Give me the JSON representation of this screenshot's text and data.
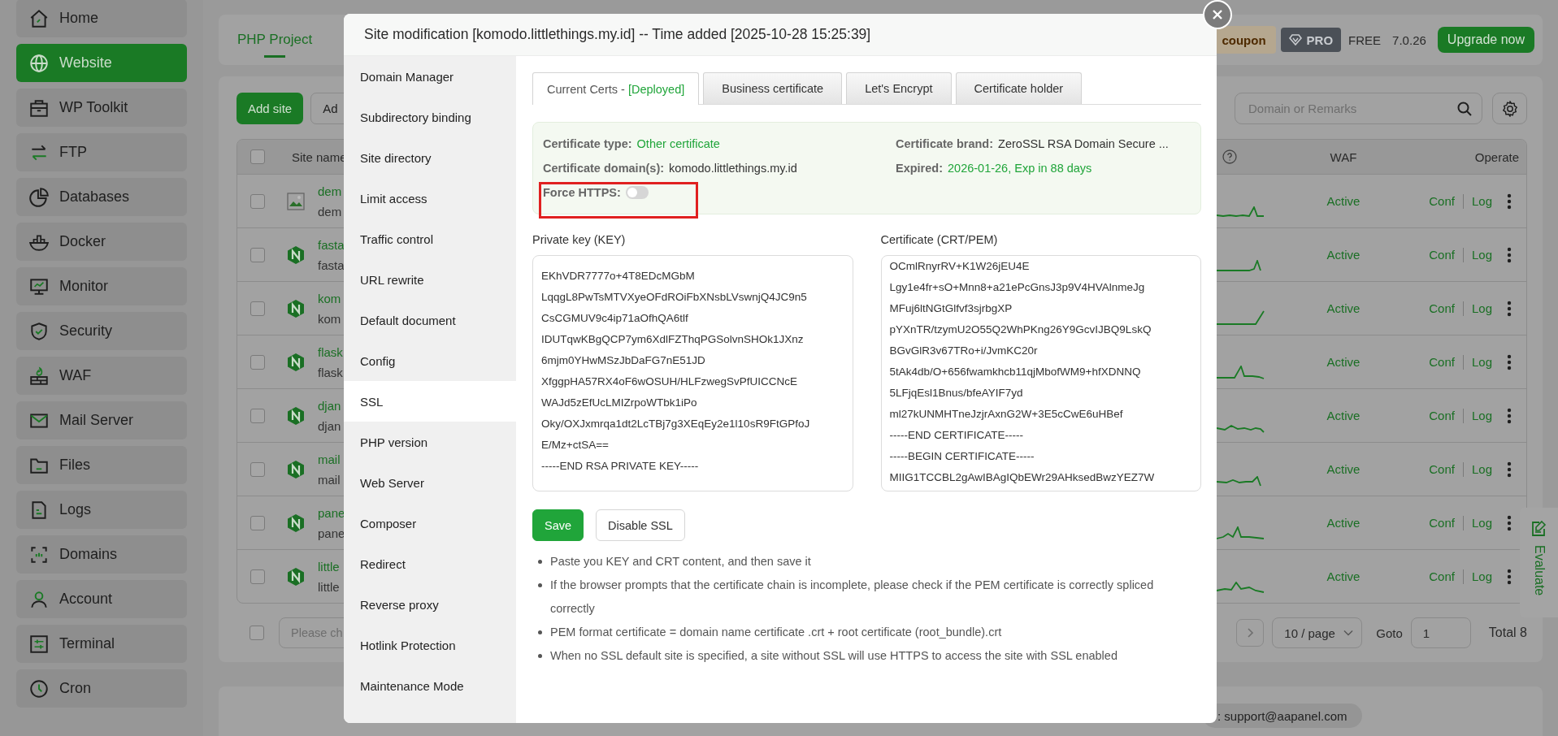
{
  "sidebar": {
    "items": [
      {
        "label": "Home",
        "selected": false
      },
      {
        "label": "Website",
        "selected": true
      },
      {
        "label": "WP Toolkit",
        "selected": false
      },
      {
        "label": "FTP",
        "selected": false
      },
      {
        "label": "Databases",
        "selected": false
      },
      {
        "label": "Docker",
        "selected": false
      },
      {
        "label": "Monitor",
        "selected": false
      },
      {
        "label": "Security",
        "selected": false
      },
      {
        "label": "WAF",
        "selected": false
      },
      {
        "label": "Mail Server",
        "selected": false
      },
      {
        "label": "Files",
        "selected": false
      },
      {
        "label": "Logs",
        "selected": false
      },
      {
        "label": "Domains",
        "selected": false
      },
      {
        "label": "Account",
        "selected": false
      },
      {
        "label": "Terminal",
        "selected": false
      },
      {
        "label": "Cron",
        "selected": false
      }
    ]
  },
  "header": {
    "tabs": [
      {
        "label": "PHP Project",
        "selected": true
      }
    ],
    "coupon": "coupon",
    "pro_badge": "PRO",
    "edition": "FREE",
    "version": "7.0.26",
    "upgrade_button": "Upgrade now"
  },
  "toolbar": {
    "add_site_button": "Add site",
    "second_button": "Ad",
    "search": {
      "placeholder": "Domain or Remarks"
    }
  },
  "table": {
    "select_all_checked": false,
    "columns": {
      "name": "Site name",
      "waf": "WAF",
      "operate": "Operate"
    },
    "rows": [
      {
        "kind": "image",
        "checked": false,
        "name": "dem",
        "remark": "dem",
        "waf": "Active",
        "conf": "Conf",
        "log": "Log"
      },
      {
        "kind": "nginx",
        "checked": false,
        "name": "fasta",
        "remark": "fasta",
        "waf": "Active",
        "conf": "Conf",
        "log": "Log"
      },
      {
        "kind": "nginx",
        "checked": false,
        "name": "kom",
        "remark": "kom",
        "waf": "Active",
        "conf": "Conf",
        "log": "Log"
      },
      {
        "kind": "nginx",
        "checked": false,
        "name": "flask",
        "remark": "flask",
        "waf": "Active",
        "conf": "Conf",
        "log": "Log"
      },
      {
        "kind": "nginx",
        "checked": false,
        "name": "djan",
        "remark": "djan",
        "waf": "Active",
        "conf": "Conf",
        "log": "Log"
      },
      {
        "kind": "nginx",
        "checked": false,
        "name": "mail",
        "remark": "mail",
        "waf": "Active",
        "conf": "Conf",
        "log": "Log"
      },
      {
        "kind": "nginx",
        "checked": false,
        "name": "pane",
        "remark": "pane",
        "waf": "Active",
        "conf": "Conf",
        "log": "Log"
      },
      {
        "kind": "nginx",
        "checked": false,
        "name": "little",
        "remark": "little",
        "waf": "Active",
        "conf": "Conf",
        "log": "Log"
      }
    ]
  },
  "footer": {
    "checked": false,
    "batch_select": {
      "placeholder": "Please ch"
    },
    "page_size": "10 / page",
    "goto_label": "Goto",
    "goto_value": "1",
    "total": "Total 8"
  },
  "support": ": support@aapanel.com",
  "evaluate": "Evaluate",
  "modal": {
    "title": "Site modification [komodo.littlethings.my.id] -- Time added [2025-10-28 15:25:39]",
    "nav": [
      {
        "label": "Domain Manager",
        "selected": false
      },
      {
        "label": "Subdirectory binding",
        "selected": false
      },
      {
        "label": "Site directory",
        "selected": false
      },
      {
        "label": "Limit access",
        "selected": false
      },
      {
        "label": "Traffic control",
        "selected": false
      },
      {
        "label": "URL rewrite",
        "selected": false
      },
      {
        "label": "Default document",
        "selected": false
      },
      {
        "label": "Config",
        "selected": false
      },
      {
        "label": "SSL",
        "selected": true
      },
      {
        "label": "PHP version",
        "selected": false
      },
      {
        "label": "Web Server",
        "selected": false
      },
      {
        "label": "Composer",
        "selected": false
      },
      {
        "label": "Redirect",
        "selected": false
      },
      {
        "label": "Reverse proxy",
        "selected": false
      },
      {
        "label": "Hotlink Protection",
        "selected": false
      },
      {
        "label": "Maintenance Mode",
        "selected": false
      }
    ],
    "tabs": [
      {
        "label": "Current Certs - ",
        "status": "[Deployed]",
        "selected": true
      },
      {
        "label": "Business certificate",
        "selected": false
      },
      {
        "label": "Let's Encrypt",
        "selected": false
      },
      {
        "label": "Certificate holder",
        "selected": false
      }
    ],
    "cert_info": {
      "type_label": "Certificate type:",
      "type": "Other certificate",
      "brand_label": "Certificate brand:",
      "brand": "ZeroSSL RSA Domain Secure ...",
      "domain_label": "Certificate domain(s):",
      "domain": "komodo.littlethings.my.id",
      "expired_label": "Expired:",
      "expired": "2026-01-26, Exp in 88 days",
      "force_https": {
        "label": "Force HTTPS:",
        "on": false,
        "highlighted": true
      }
    },
    "key": {
      "label": "Private key (KEY)",
      "lines": [
        "EKhVDR7777o+4T8EDcMGbM",
        "LqqgL8PwTsMTVXyeOFdROiFbXNsbLVswnjQ4JC9n5",
        "CsCGMUV9c4ip71aOfhQA6tlf",
        "IDUTqwKBgQCP7ym6XdlFZThqPGSolvnSHOk1JXnz",
        "6mjm0YHwMSzJbDaFG7nE51JD",
        "XfggpHA57RX4oF6wOSUH/HLFzwegSvPfUICCNcE",
        "WAJd5zEfUcLMIZrpoWTbk1iPo",
        "Oky/OXJxmrqa1dt2LcTBj7g3XEqEy2e1l10sR9FtGPfoJ",
        "E/Mz+ctSA==",
        "-----END RSA PRIVATE KEY-----"
      ]
    },
    "cert": {
      "label": "Certificate (CRT/PEM)",
      "lines": [
        "OCmlRnyrRV+K1W26jEU4E",
        "Lgy1e4fr+sO+Mnn8+a21ePcGnsJ3p9V4HVAlnmeJg",
        "MFuj6ltNGtGlfvf3sjrbgXP",
        "pYXnTR/tzymU2O55Q2WhPKng26Y9GcvIJBQ9LskQ",
        "BGvGlR3v67TRo+i/JvmKC20r",
        "5tAk4db/O+656fwamkhcb11qjMbofWM9+hfXDNNQ",
        "5LFjqEsl1Bnus/bfeAYIF7yd",
        "ml27kUNMHTneJzjrAxnG2W+3E5cCwE6uHBef",
        "-----END CERTIFICATE-----",
        "-----BEGIN CERTIFICATE-----",
        "MIIG1TCCBL2gAwIBAgIQbEWr29AHksedBwzYEZ7W"
      ]
    },
    "save_button": "Save",
    "disable_button": "Disable SSL",
    "notes": [
      "Paste you KEY and CRT content, and then save it",
      "If the browser prompts that the certificate chain is incomplete, please check if the PEM certificate is correctly spliced correctly",
      "PEM format certificate = domain name certificate .crt + root certificate (root_bundle).crt",
      "When no SSL default site is specified, a site without SSL will use HTTPS to access the site with SSL enabled"
    ]
  }
}
